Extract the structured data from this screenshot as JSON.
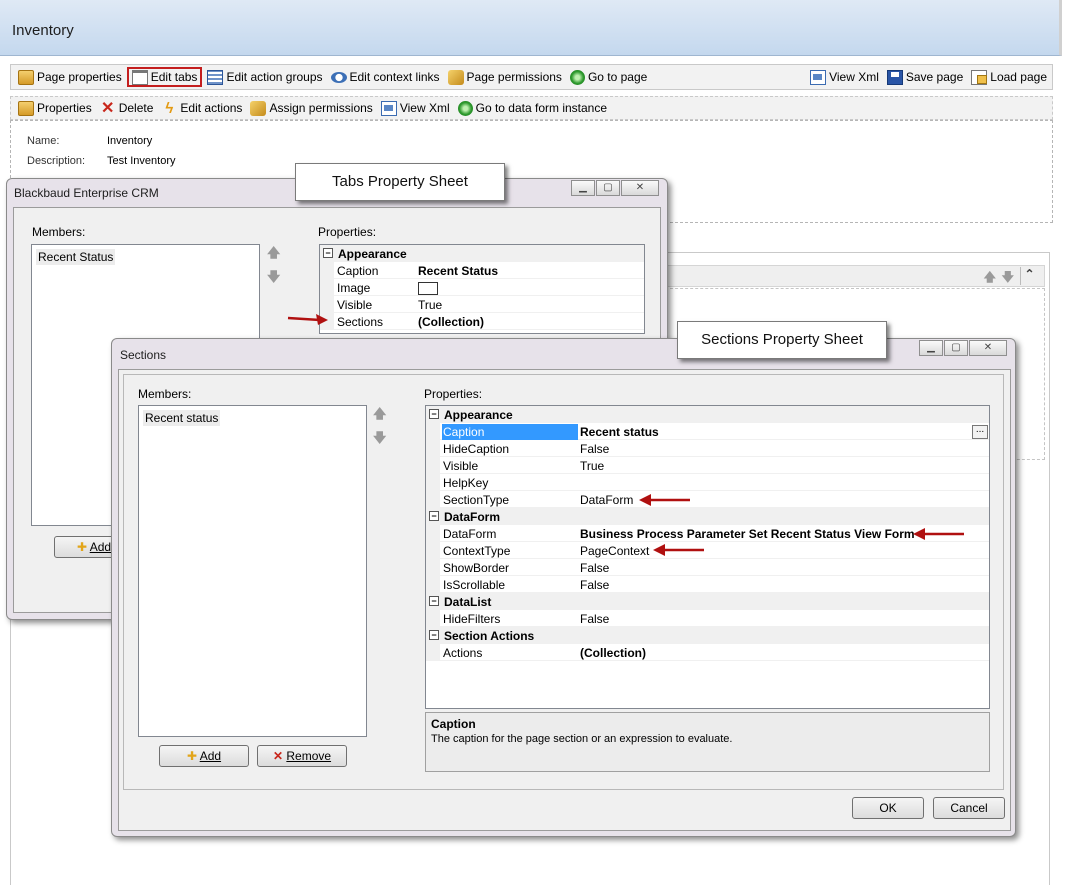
{
  "page": {
    "title": "Inventory"
  },
  "toolbar1": {
    "page_properties": "Page properties",
    "edit_tabs": "Edit tabs",
    "edit_action_groups": "Edit action groups",
    "edit_context_links": "Edit context links",
    "page_permissions": "Page permissions",
    "go_to_page": "Go to page",
    "view_xml": "View Xml",
    "save_page": "Save page",
    "load_page": "Load page"
  },
  "toolbar2": {
    "properties": "Properties",
    "delete": "Delete",
    "edit_actions": "Edit actions",
    "assign_permissions": "Assign permissions",
    "view_xml": "View Xml",
    "go_to_data_form_instance": "Go to data form instance"
  },
  "info": {
    "name_label": "Name:",
    "name_value": "Inventory",
    "description_label": "Description:",
    "description_value": "Test Inventory"
  },
  "callouts": {
    "tabs": "Tabs Property Sheet",
    "sections": "Sections Property Sheet"
  },
  "tabs_window": {
    "title": "Blackbaud Enterprise CRM",
    "members_label": "Members:",
    "properties_label": "Properties:",
    "members": [
      "Recent Status"
    ],
    "category": "Appearance",
    "rows": [
      {
        "name": "Caption",
        "value": "Recent Status",
        "bold": true
      },
      {
        "name": "Image",
        "value": ""
      },
      {
        "name": "Visible",
        "value": "True"
      },
      {
        "name": "Sections",
        "value": "(Collection)",
        "bold": true
      }
    ],
    "add_button": "Add"
  },
  "sections_window": {
    "title": "Sections",
    "members_label": "Members:",
    "properties_label": "Properties:",
    "members": [
      "Recent status"
    ],
    "categories": [
      {
        "name": "Appearance",
        "rows": [
          {
            "name": "Caption",
            "value": "Recent status",
            "bold": true,
            "selected": true
          },
          {
            "name": "HideCaption",
            "value": "False"
          },
          {
            "name": "Visible",
            "value": "True"
          },
          {
            "name": "HelpKey",
            "value": ""
          },
          {
            "name": "SectionType",
            "value": "DataForm"
          }
        ]
      },
      {
        "name": "DataForm",
        "rows": [
          {
            "name": "DataForm",
            "value": "Business Process Parameter Set Recent Status View Form",
            "bold": true
          },
          {
            "name": "ContextType",
            "value": "PageContext"
          },
          {
            "name": "ShowBorder",
            "value": "False"
          },
          {
            "name": "IsScrollable",
            "value": "False"
          }
        ]
      },
      {
        "name": "DataList",
        "rows": [
          {
            "name": "HideFilters",
            "value": "False"
          }
        ]
      },
      {
        "name": "Section Actions",
        "rows": [
          {
            "name": "Actions",
            "value": "(Collection)",
            "bold": true
          }
        ]
      }
    ],
    "description_title": "Caption",
    "description_text": "The caption for the page section or an expression to evaluate.",
    "add_button": "Add",
    "remove_button": "Remove",
    "ok_button": "OK",
    "cancel_button": "Cancel",
    "ellipsis": "..."
  },
  "colors": {
    "accent_red": "#b01010",
    "selection": "#3399ff",
    "header": "#c4d8ee"
  }
}
